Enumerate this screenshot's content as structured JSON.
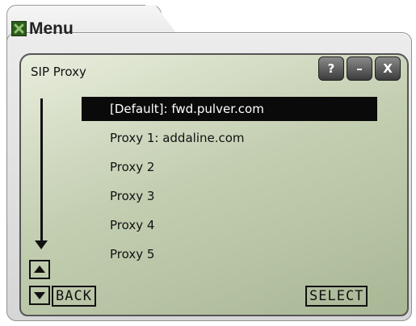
{
  "window": {
    "title": "Menu",
    "buttons": {
      "help": "?",
      "minimize": "–",
      "close": "X"
    }
  },
  "panel": {
    "title": "SIP Proxy",
    "items": [
      {
        "label": "[Default]: fwd.pulver.com",
        "selected": true
      },
      {
        "label": "Proxy 1: addaline.com"
      },
      {
        "label": "Proxy 2"
      },
      {
        "label": "Proxy 3"
      },
      {
        "label": "Proxy 4"
      },
      {
        "label": "Proxy 5"
      }
    ],
    "soft_keys": {
      "back": "BACK",
      "select": "SELECT"
    }
  },
  "icons": [
    "menu-app-icon",
    "scroll-up-icon",
    "scroll-down-icon",
    "down-arrow-indicator-icon"
  ]
}
